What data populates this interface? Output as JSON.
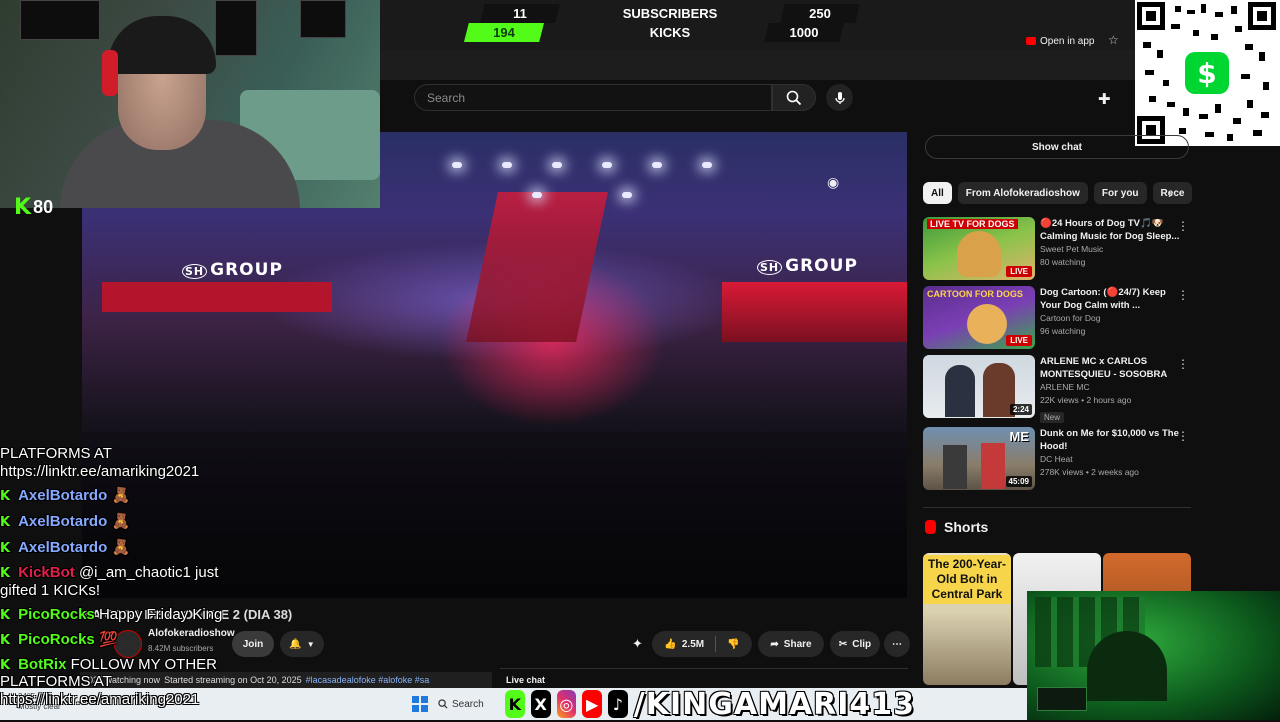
{
  "counter": {
    "subs_current": "11",
    "subs_label": "SUBSCRIBERS",
    "subs_goal": "250",
    "kicks_current": "194",
    "kicks_label": "KICKS",
    "kicks_goal": "1000"
  },
  "kick_badge": {
    "letter": "K",
    "count": "80"
  },
  "youtube": {
    "open_in_app": "Open in app",
    "search_placeholder": "Search",
    "show_chat": "Show chat",
    "chips": [
      "All",
      "From Alofokeradioshow",
      "For you",
      "Rece"
    ],
    "recommendations": [
      {
        "title": "🔴24 Hours of Dog TV🎵🐶 Calming Music for Dog Sleep...",
        "channel": "Sweet Pet Music",
        "stats": "80 watching",
        "badge": "LIVE",
        "thumb_text": "LIVE TV FOR DOGS"
      },
      {
        "title": "Dog Cartoon: (🔴24/7) Keep Your Dog Calm with ...",
        "channel": "Cartoon for Dog",
        "stats": "96 watching",
        "badge": "LIVE",
        "thumb_text": "CARTOON FOR DOGS"
      },
      {
        "title": "ARLENE MC x CARLOS MONTESQUIEU - SOSOBRA",
        "channel": "ARLENE MC",
        "stats": "22K views • 2 hours ago",
        "badge": "2:24",
        "tag": "New"
      },
      {
        "title": "Dunk on Me for $10,000 vs The Hood!",
        "channel": "DC Heat",
        "stats": "278K views • 2 weeks ago",
        "badge": "45:09",
        "thumb_text": "ME"
      }
    ],
    "shorts_label": "Shorts",
    "shorts": [
      {
        "text": "The 200-Year-Old Bolt in Central Park"
      }
    ],
    "video": {
      "stage_text_left": "GROUP",
      "stage_text_right": "GROUP",
      "title_overlay": "LA CASA DE ALOFOKE 2 (DIA 38)",
      "channel": "Alofokeradioshow",
      "subscribers": "8.42M subscribers",
      "join": "Join",
      "likes": "2.5M",
      "share": "Share",
      "clip": "Clip",
      "desc_watching": "025 watching now",
      "desc_started": "Started streaming on Oct 20, 2025",
      "desc_tags": "#lacasadealofoke #alofoke #sa",
      "live_chat": "Live chat"
    }
  },
  "chat": [
    {
      "user": "",
      "text": "PLATFORMS AT"
    },
    {
      "user": "",
      "text": "https://linktr.ee/amariking2021"
    },
    {
      "user": "AxelBotardo",
      "text": "🧸",
      "color": "#86a8ff"
    },
    {
      "user": "AxelBotardo",
      "text": "🧸",
      "color": "#86a8ff"
    },
    {
      "user": "AxelBotardo",
      "text": "🧸",
      "color": "#86a8ff"
    },
    {
      "user": "KickBot",
      "text": "@i_am_chaotic1 just",
      "color": "#e0204a"
    },
    {
      "user": "",
      "text": "gifted 1 KICKs!"
    },
    {
      "user": "PicoRocks",
      "text": "Happy Friday King",
      "color": "#53fc18"
    },
    {
      "user": "PicoRocks",
      "text": "💯",
      "color": "#53fc18"
    },
    {
      "user": "BotRix",
      "text": "FOLLOW MY OTHER",
      "color": "#53fc18"
    },
    {
      "user": "",
      "text": "PLATFORMS AT"
    },
    {
      "user": "",
      "text": "https://linktr.ee/amariking2021"
    }
  ],
  "taskbar": {
    "search": "Search",
    "weather_temp": "34°F",
    "weather_desc": "Mostly clear",
    "handle": "/KINGAMARI413",
    "social_icons": [
      "kick-icon",
      "x-icon",
      "instagram-icon",
      "youtube-icon",
      "tiktok-icon"
    ]
  },
  "qr": {
    "cash_symbol": "$"
  },
  "colors": {
    "kick_green": "#53fc18",
    "youtube_red": "#ff0000",
    "cashapp_green": "#00d632"
  }
}
